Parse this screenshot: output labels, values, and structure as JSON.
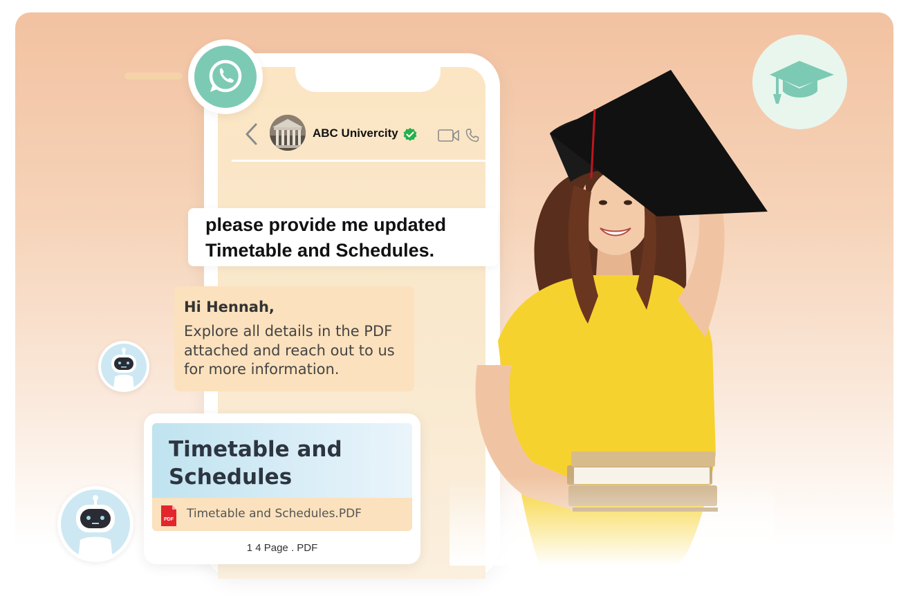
{
  "chat": {
    "contact_name": "ABC Univercity",
    "user_message": "please provide me updated Timetable and Schedules.",
    "bot_greeting": "Hi Hennah,",
    "bot_message": "Explore all details in the PDF attached and reach out to us for more information."
  },
  "attachment": {
    "preview_title": "Timetable and Schedules",
    "filename": "Timetable and Schedules.PDF",
    "icon_label": "PDF",
    "meta": "1 4 Page . PDF"
  },
  "icons": {
    "whatsapp": "whatsapp-icon",
    "graduation_cap": "graduation-cap-icon",
    "back": "back-arrow-icon",
    "verified": "verified-check-icon",
    "video": "video-call-icon",
    "phone": "phone-call-icon",
    "bot": "chatbot-avatar-icon"
  },
  "colors": {
    "whatsapp_green": "#7ccab4",
    "verified_green": "#25b04a",
    "bubble_peach": "#fbe1bd",
    "pdf_red": "#e3262b"
  }
}
